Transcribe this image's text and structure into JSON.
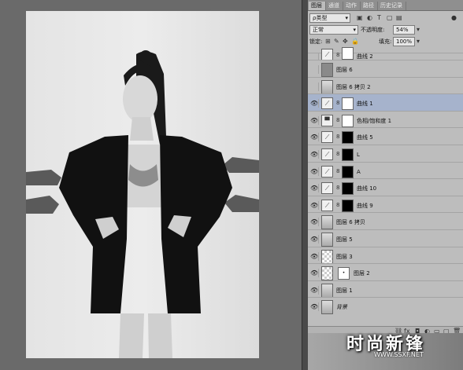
{
  "tabs": [
    "图层",
    "通道",
    "动作",
    "路径",
    "历史记录"
  ],
  "filter": {
    "kind": "ρ类型",
    "icons": [
      "pixel-filter-icon",
      "adjustment-filter-icon",
      "type-filter-icon",
      "shape-filter-icon",
      "smart-filter-icon"
    ]
  },
  "blend": {
    "mode": "正常",
    "opacity_label": "不透明度:",
    "opacity": "54%"
  },
  "lock": {
    "label": "锁定:",
    "fill_label": "填充:",
    "fill": "100%"
  },
  "layers": [
    {
      "name": "曲线 2",
      "vis": "",
      "thumb": "adjust",
      "mask": "white"
    },
    {
      "name": "图层 6",
      "vis": "",
      "thumb": "gray",
      "mask": ""
    },
    {
      "name": "图层 6 拷贝 2",
      "vis": "",
      "thumb": "photo",
      "mask": ""
    },
    {
      "name": "曲线 1",
      "vis": "👁",
      "thumb": "adjust",
      "mask": "white",
      "selected": true
    },
    {
      "name": "色相/饱和度 1",
      "vis": "👁",
      "thumb": "hue",
      "mask": "white"
    },
    {
      "name": "曲线 5",
      "vis": "👁",
      "thumb": "adjust",
      "mask": "black"
    },
    {
      "name": "L",
      "vis": "👁",
      "thumb": "adjust",
      "mask": "black"
    },
    {
      "name": "A",
      "vis": "👁",
      "thumb": "adjust",
      "mask": "black"
    },
    {
      "name": "曲线 10",
      "vis": "👁",
      "thumb": "adjust",
      "mask": "black"
    },
    {
      "name": "曲线 9",
      "vis": "👁",
      "thumb": "adjust",
      "mask": "black"
    },
    {
      "name": "图层 6 拷贝",
      "vis": "👁",
      "thumb": "photo",
      "mask": ""
    },
    {
      "name": "图层 5",
      "vis": "👁",
      "thumb": "photo",
      "mask": ""
    },
    {
      "name": "图层 3",
      "vis": "👁",
      "thumb": "checker",
      "mask": ""
    },
    {
      "name": "图层 2",
      "vis": "👁",
      "thumb": "checker",
      "mask": "dot"
    },
    {
      "name": "图层 1",
      "vis": "👁",
      "thumb": "photo",
      "mask": ""
    },
    {
      "name": "背景",
      "vis": "👁",
      "thumb": "photo",
      "mask": ""
    }
  ],
  "bottom_icons": [
    "link-icon",
    "fx-icon",
    "mask-icon",
    "adjust-icon",
    "folder-icon",
    "new-layer-icon",
    "trash-icon"
  ],
  "watermark": {
    "cn": "时尚新锋",
    "url": "WWW.SSXF.NET"
  }
}
